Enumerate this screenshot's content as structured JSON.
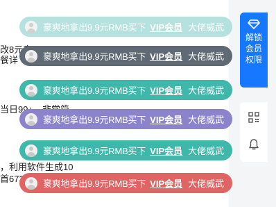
{
  "background_text": [
    "改8元直",
    "餐详",
    "当日99+，非常简",
    "，利用软件生成10",
    "首673"
  ],
  "banners": [
    {
      "message": "豪爽地拿出9.9元RMB买下",
      "vip": "VIP会员",
      "tail": "大佬威武",
      "color": "#a9ddda",
      "opacity": 0.85
    },
    {
      "message": "豪爽地拿出9.9元RMB买下",
      "vip": "VIP会员",
      "tail": "大佬威武",
      "color": "#5f6a74",
      "opacity": 1
    },
    {
      "message": "豪爽地拿出9.9元RMB买下",
      "vip": "VIP会员",
      "tail": "大佬威武",
      "color": "#3fb8ab",
      "opacity": 1
    },
    {
      "message": "豪爽地拿出9.9元RMB买下",
      "vip": "VIP会员",
      "tail": "大佬威武",
      "color": "#8b84cc",
      "opacity": 1
    },
    {
      "message": "豪爽地拿出9.9元RMB买下",
      "vip": "VIP会员",
      "tail": "大佬威武",
      "color": "#3fb8ab",
      "opacity": 1
    },
    {
      "message": "豪爽地拿出9.9元RMB买下",
      "vip": "VIP会员",
      "tail": "大佬威武",
      "color": "#e06464",
      "opacity": 1
    }
  ],
  "sidebar": {
    "unlock_label": "解锁会员权限",
    "unlock_icon": "diamond-icon",
    "qr_icon": "qr-code-icon",
    "bell_icon": "bell-icon",
    "accent": "#1677ff"
  }
}
